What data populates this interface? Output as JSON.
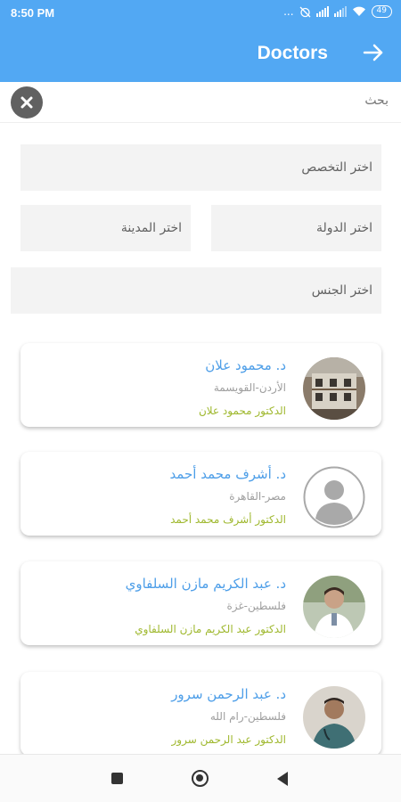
{
  "status_bar": {
    "time": "8:50 PM",
    "icons_text": "...",
    "battery": "49"
  },
  "app_bar": {
    "title": "Doctors",
    "back_icon": "arrow-right-icon"
  },
  "search": {
    "placeholder": "بحث",
    "clear_icon": "close-icon"
  },
  "filters": {
    "specialty": "اختر التخصص",
    "country": "اختر الدولة",
    "city": "اختر المدينة",
    "gender": "اختر الجنس"
  },
  "doctors": [
    {
      "name": "د. محمود علان",
      "location": "الأردن-القويسمة",
      "subtitle": "الدكتور محمود علان",
      "avatar": "building-photo"
    },
    {
      "name": "د. أشرف محمد أحمد",
      "location": "مصر-القاهرة",
      "subtitle": "الدكتور أشرف محمد أحمد",
      "avatar": "default-person"
    },
    {
      "name": "د. عبد الكريم مازن السلفاوي",
      "location": "فلسطين-غزة",
      "subtitle": "الدكتور عبد الكريم مازن السلفاوي",
      "avatar": "person-photo"
    },
    {
      "name": "د. عبد الرحمن سرور",
      "location": "فلسطين-رام الله",
      "subtitle": "الدكتور عبد الرحمن سرور",
      "avatar": "person-photo"
    }
  ],
  "nav": {
    "recents_icon": "square-icon",
    "home_icon": "circle-icon",
    "back_icon": "triangle-back-icon"
  },
  "colors": {
    "primary": "#52a8f3",
    "name": "#4d9ee8",
    "subtitle": "#9fb82e"
  }
}
